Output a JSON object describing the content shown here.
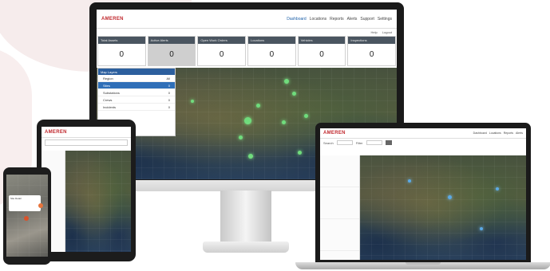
{
  "desktop": {
    "logo": "AMEREN",
    "nav": [
      "Dashboard",
      "Locations",
      "Reports",
      "Alerts",
      "Support",
      "Settings"
    ],
    "subnav": [
      "Help",
      "Logout"
    ],
    "kpis": [
      {
        "label": "Total Assets",
        "value": "0"
      },
      {
        "label": "Active Alerts",
        "value": "0"
      },
      {
        "label": "Open Work Orders",
        "value": "0"
      },
      {
        "label": "Locations",
        "value": "0"
      },
      {
        "label": "Vehicles",
        "value": "0"
      },
      {
        "label": "Inspections",
        "value": "0"
      }
    ],
    "layers": {
      "title": "Map Layers",
      "rows": [
        {
          "label": "Region",
          "count": "All"
        },
        {
          "label": "Sites",
          "count": "0"
        },
        {
          "label": "Substations",
          "count": "0"
        },
        {
          "label": "Crews",
          "count": "0"
        },
        {
          "label": "Incidents",
          "count": "0"
        }
      ]
    }
  },
  "laptop": {
    "logo": "AMEREN",
    "nav": [
      "Dashboard",
      "Locations",
      "Reports",
      "Alerts"
    ],
    "tools": [
      "Search",
      "Filter"
    ]
  },
  "tablet": {
    "logo": "AMEREN"
  },
  "phone": {
    "card_line": "Site Detail"
  }
}
